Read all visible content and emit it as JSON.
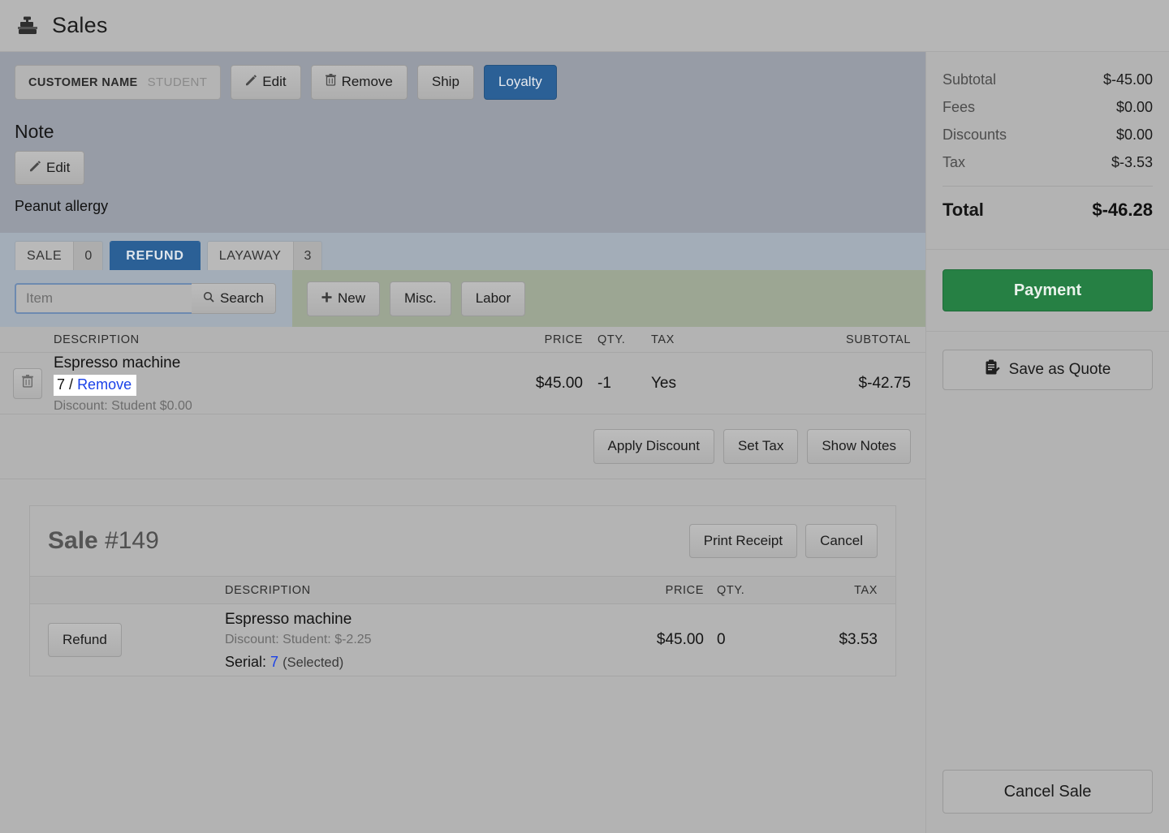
{
  "header": {
    "title": "Sales",
    "icon": "cash-register-icon"
  },
  "customer": {
    "name_label": "CUSTOMER NAME",
    "name_value": "STUDENT",
    "edit_label": "Edit",
    "remove_label": "Remove",
    "ship_label": "Ship",
    "loyalty_label": "Loyalty",
    "edit_icon": "pencil-icon",
    "remove_icon": "trash-icon"
  },
  "note": {
    "heading": "Note",
    "edit_label": "Edit",
    "edit_icon": "pencil-icon",
    "text": "Peanut allergy"
  },
  "tabs": [
    {
      "label": "SALE",
      "count": "0",
      "active": false
    },
    {
      "label": "REFUND",
      "count": "",
      "active": true
    },
    {
      "label": "LAYAWAY",
      "count": "3",
      "active": false
    }
  ],
  "search": {
    "placeholder": "Item",
    "value": "",
    "button_label": "Search",
    "button_icon": "search-icon"
  },
  "item_actions": {
    "new_label": "New",
    "new_icon": "plus-icon",
    "misc_label": "Misc.",
    "labor_label": "Labor"
  },
  "items_table": {
    "columns": [
      "DESCRIPTION",
      "PRICE",
      "QTY.",
      "TAX",
      "SUBTOTAL"
    ],
    "rows": [
      {
        "delete_icon": "trash-icon",
        "name": "Espresso machine",
        "serial": "7",
        "serial_separator": "/",
        "serial_remove_label": "Remove",
        "discount": "Discount: Student $0.00",
        "price": "$45.00",
        "qty": "-1",
        "tax": "Yes",
        "subtotal": "$-42.75"
      }
    ]
  },
  "sub_actions": {
    "apply_discount_label": "Apply Discount",
    "set_tax_label": "Set Tax",
    "show_notes_label": "Show Notes"
  },
  "sale_card": {
    "title_prefix": "Sale",
    "title_number": "#149",
    "print_receipt_label": "Print Receipt",
    "cancel_label": "Cancel",
    "columns": [
      "DESCRIPTION",
      "PRICE",
      "QTY.",
      "TAX"
    ],
    "rows": [
      {
        "refund_label": "Refund",
        "name": "Espresso machine",
        "discount": "Discount: Student: $-2.25",
        "serial_label": "Serial:",
        "serial_value": "7",
        "serial_state": "(Selected)",
        "price": "$45.00",
        "qty": "0",
        "tax": "$3.53"
      }
    ]
  },
  "totals": {
    "rows": [
      {
        "label": "Subtotal",
        "value": "$-45.00"
      },
      {
        "label": "Fees",
        "value": "$0.00"
      },
      {
        "label": "Discounts",
        "value": "$0.00"
      },
      {
        "label": "Tax",
        "value": "$-3.53"
      }
    ],
    "total_label": "Total",
    "total_value": "$-46.28"
  },
  "sidebar_actions": {
    "payment_label": "Payment",
    "save_quote_label": "Save as Quote",
    "save_quote_icon": "clipboard-pencil-icon",
    "cancel_sale_label": "Cancel Sale"
  },
  "colors": {
    "accent_blue": "#2b6096",
    "accent_green": "#268044",
    "link_blue": "#1a41e8",
    "customer_panel": "#979ca6",
    "tabs_strip": "#a3adb8",
    "action_zone": "#9ca693",
    "page_bg": "#b3b3b3",
    "highlight": "#ffffff"
  }
}
